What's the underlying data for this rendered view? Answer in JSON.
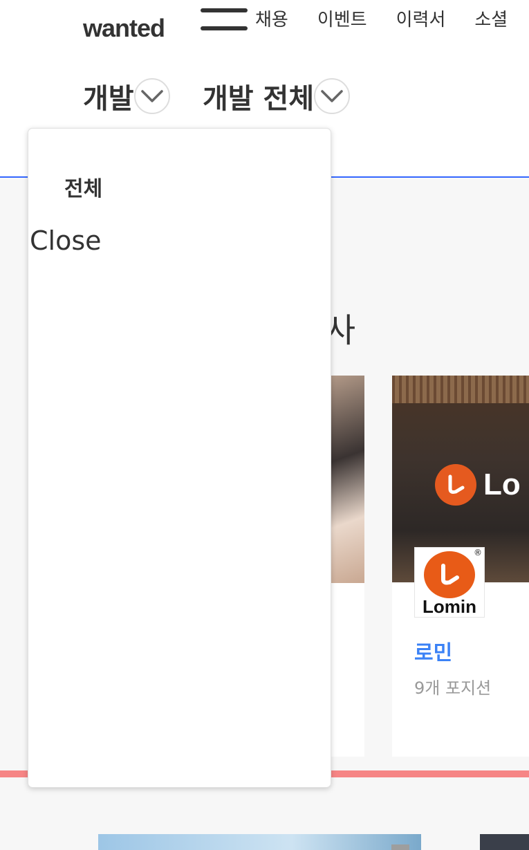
{
  "header": {
    "logo": "wanted",
    "nav": [
      "채용",
      "이벤트",
      "이력서",
      "소셜"
    ],
    "category": "개발",
    "subcategory": "개발 전체"
  },
  "main": {
    "section_title_fragment": "사",
    "featured_company": {
      "brand_overlay": "Lo",
      "logo_word": "Lomin",
      "logo_mark": "®",
      "name": "로민",
      "positions": "9개 포지션"
    }
  },
  "dropdown": {
    "items": [
      "전체"
    ],
    "close_label": "Close"
  },
  "colors": {
    "accent_blue": "#3366ff",
    "company_link": "#3b82f6",
    "brand_orange": "#e85b17",
    "divider_red": "#f68585"
  }
}
